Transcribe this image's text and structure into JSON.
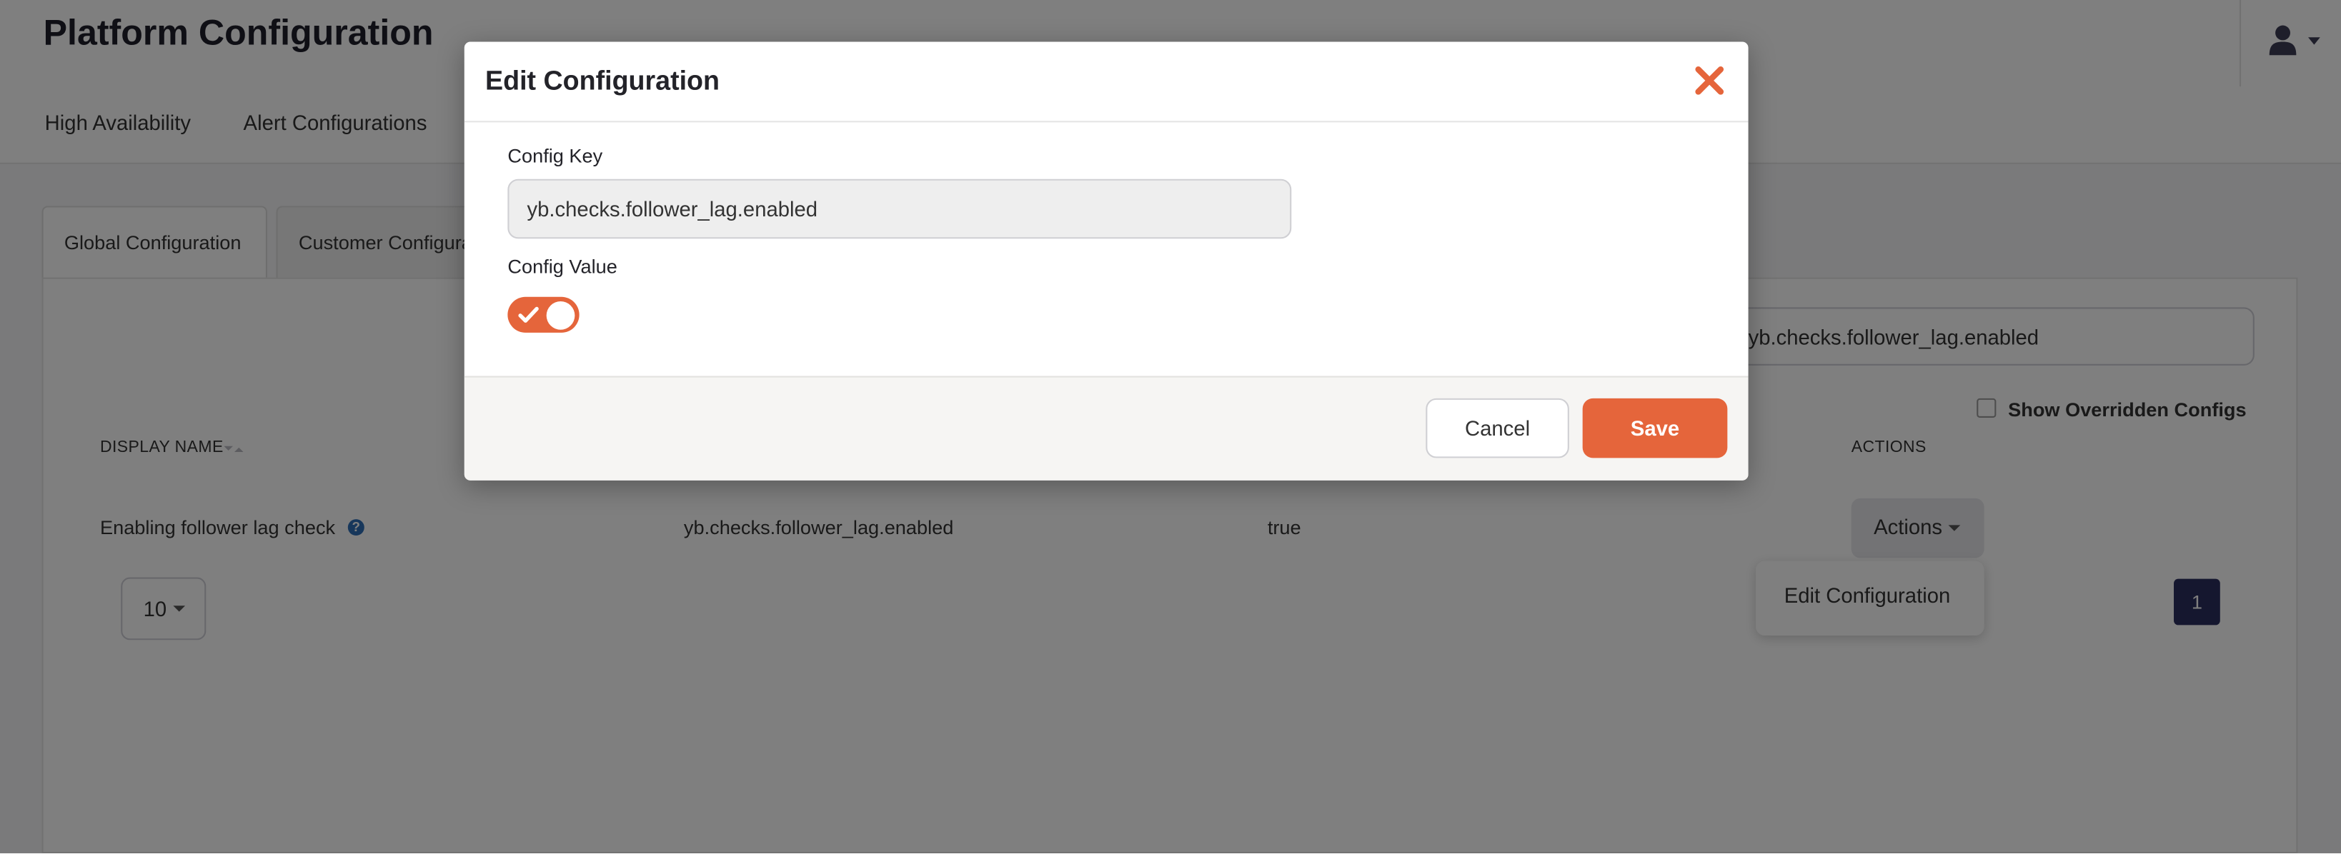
{
  "header": {
    "title": "Platform Configuration",
    "user_icon": "user-icon"
  },
  "nav": {
    "items": [
      "High Availability",
      "Alert Configurations"
    ]
  },
  "tabs": [
    {
      "label": "Global Configuration",
      "active": true
    },
    {
      "label": "Customer Configuration",
      "active": false
    }
  ],
  "search": {
    "value": "yb.checks.follower_lag.enabled"
  },
  "filters": {
    "show_overridden_label": "Show Overridden Configs",
    "show_overridden_checked": false
  },
  "table": {
    "columns": [
      "DISPLAY NAME",
      "ACTIONS"
    ],
    "rows": [
      {
        "display_name": "Enabling follower lag check",
        "key": "yb.checks.follower_lag.enabled",
        "value": "true",
        "actions_label": "Actions"
      }
    ],
    "help_icon": "question-circle-icon"
  },
  "actions_menu": {
    "items": [
      "Edit Configuration"
    ]
  },
  "pagination": {
    "page_size": "10",
    "current_page": "1"
  },
  "modal": {
    "title": "Edit Configuration",
    "close_icon": "close-icon",
    "key_label": "Config Key",
    "key_value": "yb.checks.follower_lag.enabled",
    "value_label": "Config Value",
    "toggle_on": true,
    "cancel_label": "Cancel",
    "save_label": "Save"
  },
  "colors": {
    "accent": "#e5653b",
    "pagination_active": "#2b2f5e",
    "help_icon": "#2f6fb7"
  }
}
